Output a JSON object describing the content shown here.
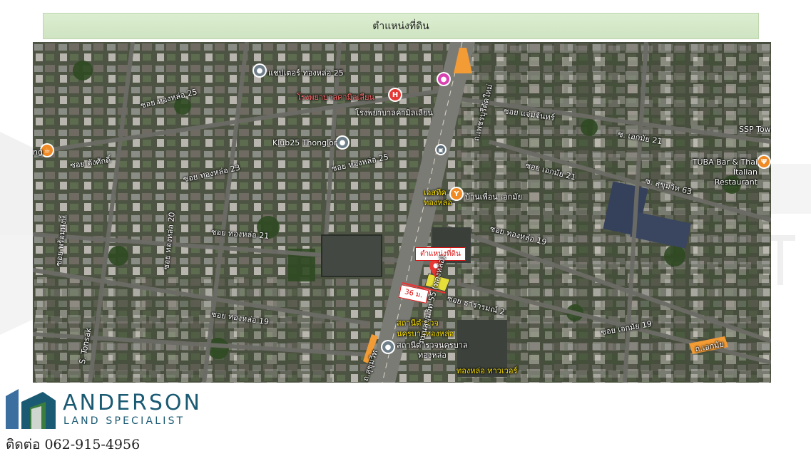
{
  "banner": {
    "title": "ตำแหน่งที่ดิน"
  },
  "map": {
    "labels": {
      "chapter": "แชปเตอร์ ทองหล่อ 25",
      "hospital": "โรงพยาบาลคามิลเลียน",
      "hospital_sub": "โรงพยาบาลคามิลเลียน",
      "klub": "Klub25 Thonglor",
      "soi25_left": "ซอย ทองหล่อ 25",
      "soi25_mid": "ซอย ทองหล่อ 25",
      "soi23": "ซอย ทองหล่อ 23",
      "sawatsak": "ซอย ตังศักดิ์",
      "phetchaburi": "ถ.เพชรบุรีตัดใหม่",
      "soi_aengchan": "ซอย แจ่มจันทร์",
      "ekkamai21_a": "ซ. เอกมัย 21",
      "ekkamai21_b": "ซอย เอกมัย 21",
      "sukhumvit63": "ซ. สุขุมวิท 63",
      "tuba": "TUBA Bar & Thai Italian Restaurant",
      "ssp": "SSP Tower",
      "ng": "ng",
      "estique": "เอสทีค ทองหล่อ",
      "baan_phuean": "บ้านเพื่อน เอกมัย",
      "thonglor_road": "ถนนสุขุมวิท 55 (ทองหล่อ)",
      "soi21_center": "ซอย ทองหล่อ 21",
      "soi19": "ซอย ทองหล่อ 19",
      "soi19_left": "ซอย ทองหล่อ 19",
      "soi_left_vertical": "ซอย ทองหล่อ 20",
      "soi_phrompong": "ซอย พร้อมพงษ์",
      "soi_tonsak": "S. Tonsak",
      "dararom": "ซอย ธารารมณ์ 2",
      "police_1": "สถานีตำรวจ",
      "police_2": "นครบาลทองหล่อ",
      "police_3": "สถานีตำรวจนครบาล",
      "police_4": "ทองหล่อ",
      "sukhumvit_arrow": "ถ.สุขุมวิท",
      "ekkamai_arrow": "ถ.เอกมัย",
      "thonglor_tower": "ทองหล่อ ทาวเวอร์",
      "ekkamai19": "ซอย เอกมัย 19"
    },
    "site_tag": "ตำแหน่งที่ดิน",
    "frontage": "36 ม.",
    "hospital_icon": "H"
  },
  "brand": {
    "name": "ANDERSON",
    "subtitle": "LAND SPECIALIST"
  },
  "contact": {
    "text": "ติดต่อ 062-915-4956"
  },
  "colors": {
    "banner_bg": "#d6e9ca",
    "brand": "#1b5a73",
    "logo_green": "#3a7d3e",
    "marker": "#e53935",
    "site": "#e8e03a"
  },
  "icons": [
    "location-pin-icon",
    "hospital-icon",
    "restaurant-icon",
    "cafe-icon",
    "bus-icon",
    "police-icon"
  ]
}
